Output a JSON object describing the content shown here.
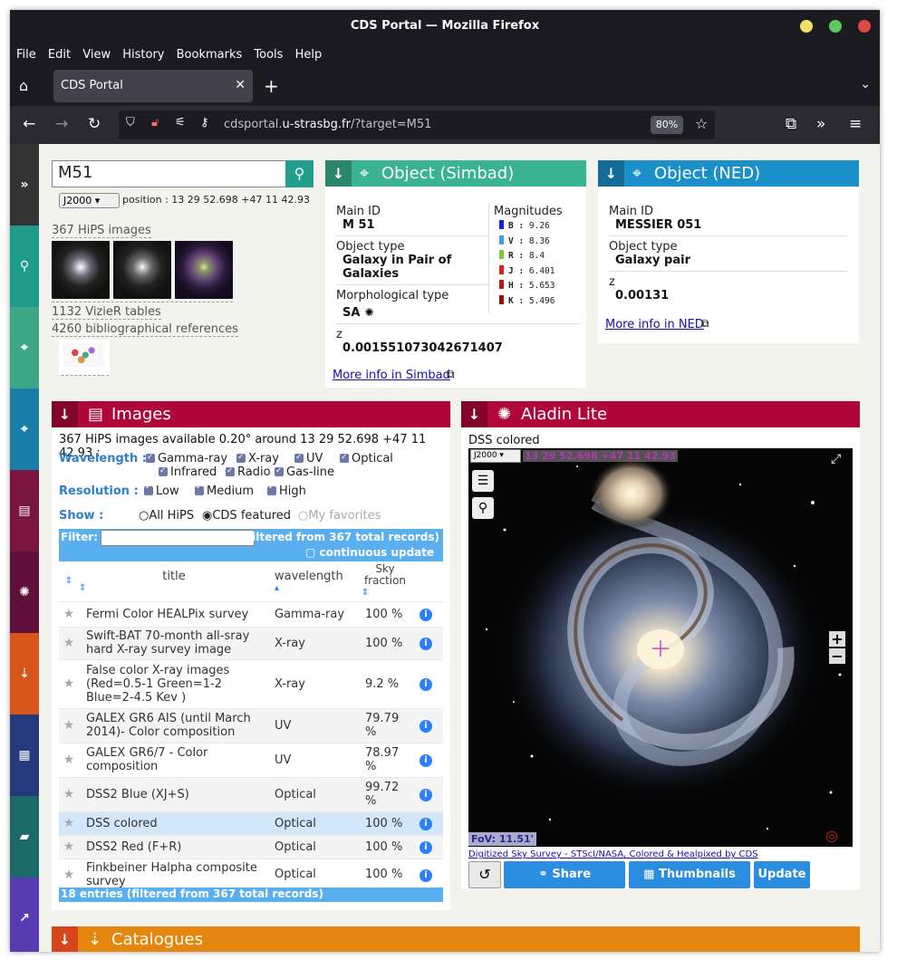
{
  "window": {
    "title": "CDS Portal — Mozilla Firefox"
  },
  "menu": [
    "File",
    "Edit",
    "View",
    "History",
    "Bookmarks",
    "Tools",
    "Help"
  ],
  "tab": {
    "title": "CDS Portal"
  },
  "nav": {
    "url_host": "cdsportal.",
    "url_domain": "u-strasbg.fr",
    "url_path": "/?target=M51",
    "zoom": "80%"
  },
  "search": {
    "query": "M51",
    "frame": "J2000",
    "position": "position : 13 29 52.698 +47 11 42.93"
  },
  "summary": {
    "hips": "367 HiPS images",
    "vizier": "1132 VizieR tables",
    "biblio": "4260 bibliographical references"
  },
  "simbad": {
    "header": "Object (Simbad)",
    "main_id_label": "Main ID",
    "main_id": "M 51",
    "type_label": "Object type",
    "type": "Galaxy in Pair of Galaxies",
    "morph_label": "Morphological type",
    "morph": "SA",
    "z_label": "z",
    "z": "0.001551073042671407",
    "mag_label": "Magnitudes",
    "magnitudes": [
      {
        "band": "B :",
        "value": "9.26",
        "color": "#1a1aff"
      },
      {
        "band": "V :",
        "value": "8.36",
        "color": "#3aa0e8"
      },
      {
        "band": "R :",
        "value": "8.4",
        "color": "#7ec73a"
      },
      {
        "band": "J :",
        "value": "6.401",
        "color": "#e02020"
      },
      {
        "band": "H :",
        "value": "5.653",
        "color": "#c01818"
      },
      {
        "band": "K :",
        "value": "5.496",
        "color": "#9a1010"
      }
    ],
    "link": "More info in Simbad"
  },
  "ned": {
    "header": "Object (NED)",
    "main_id_label": "Main ID",
    "main_id": "MESSIER 051",
    "type_label": "Object type",
    "type": "Galaxy pair",
    "z_label": "z",
    "z": "0.00131",
    "link": "More info in NED"
  },
  "images": {
    "header": "Images",
    "available": "367 HiPS images available 0.20° around 13 29 52.698 +47 11 42.93 :",
    "wavelength_label": "Wavelength :",
    "wavelengths": [
      "Gamma-ray",
      "X-ray",
      "UV",
      "Optical",
      "Infrared",
      "Radio",
      "Gas-line"
    ],
    "resolution_label": "Resolution :",
    "resolutions": [
      "Low",
      "Medium",
      "High"
    ],
    "show_label": "Show :",
    "show_options": [
      "All HiPS",
      "CDS featured",
      "My favorites"
    ],
    "filter_label": "Filter:",
    "entries": "18 entries (filtered from 367 total records)",
    "continuous": "continuous update",
    "col_title": "title",
    "col_wavelength": "wavelength",
    "col_sky": "Sky fraction",
    "rows": [
      {
        "title": "Fermi Color HEALPix survey",
        "wavelength": "Gamma-ray",
        "sky": "100 %"
      },
      {
        "title": "Swift-BAT 70-month all-sray hard X-ray survey image",
        "wavelength": "X-ray",
        "sky": "100 %"
      },
      {
        "title": "False color X-ray images (Red=0.5-1 Green=1-2 Blue=2-4.5 Kev )",
        "wavelength": "X-ray",
        "sky": "9.2 %"
      },
      {
        "title": "GALEX GR6 AIS (until March 2014)- Color composition",
        "wavelength": "UV",
        "sky": "79.79 %"
      },
      {
        "title": "GALEX GR6/7 - Color composition",
        "wavelength": "UV",
        "sky": "78.97 %"
      },
      {
        "title": "DSS2 Blue (XJ+S)",
        "wavelength": "Optical",
        "sky": "99.72 %"
      },
      {
        "title": "DSS colored",
        "wavelength": "Optical",
        "sky": "100 %"
      },
      {
        "title": "DSS2 Red (F+R)",
        "wavelength": "Optical",
        "sky": "100 %"
      },
      {
        "title": "Finkbeiner Halpha composite survey",
        "wavelength": "Optical",
        "sky": "100 %"
      }
    ],
    "footer": "18 entries (filtered from 367 total records)"
  },
  "aladin": {
    "header": "Aladin Lite",
    "survey": "DSS colored",
    "frame": "J2000",
    "coords": "13 29 52.698 +47 11 42.93",
    "fov": "FoV: 11.51'",
    "credit": "Digitized Sky Survey - STScI/NASA, Colored & Healpixed by CDS",
    "share": "Share",
    "thumbnails": "Thumbnails",
    "update": "Update"
  },
  "catalogues": {
    "header": "Catalogues"
  }
}
